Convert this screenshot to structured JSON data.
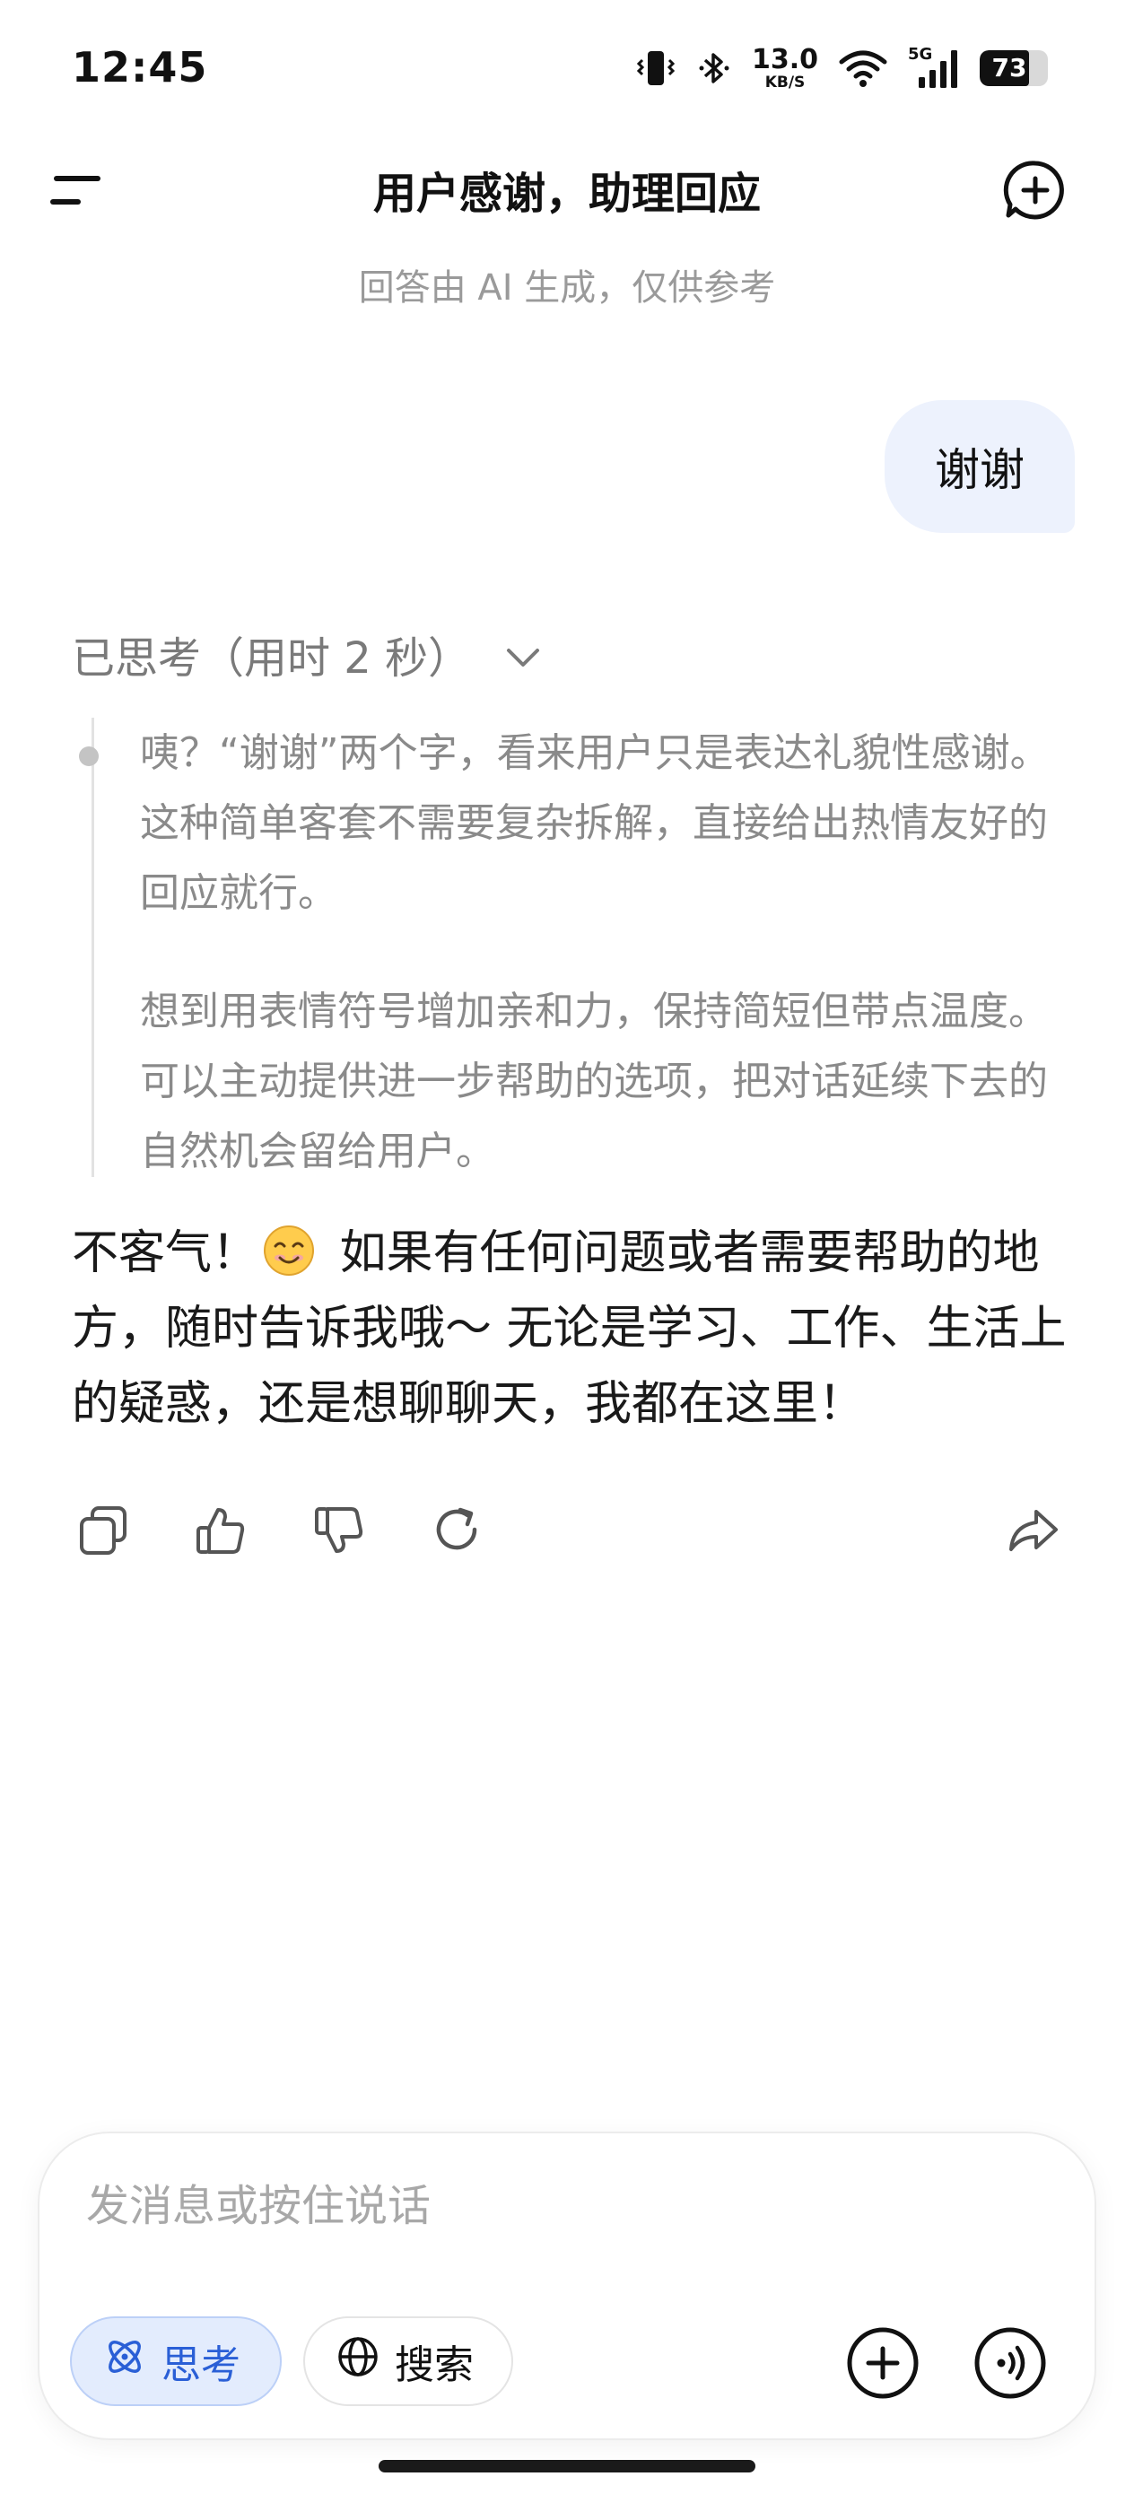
{
  "status_bar": {
    "time": "12:45",
    "net_speed_value": "13.0",
    "net_speed_unit": "KB/S",
    "network_type": "5G",
    "battery_percent": "73",
    "battery_level": 0.73,
    "icons": [
      "vibrate-icon",
      "bluetooth-icon",
      "wifi-icon",
      "cellular-signal-icon",
      "battery-icon"
    ]
  },
  "header": {
    "title": "用户感谢，助理回应",
    "notice": "回答由 AI 生成，仅供参考"
  },
  "conversation": {
    "user_message": "谢谢",
    "thinking": {
      "label": "已思考（用时 2 秒）",
      "paragraphs": [
        "咦？“谢谢”两个字，看来用户只是表达礼貌性感谢。这种简单客套不需要复杂拆解，直接给出热情友好的回应就行。",
        "想到用表情符号增加亲和力，保持简短但带点温度。可以主动提供进一步帮助的选项，把对话延续下去的自然机会留给用户。"
      ]
    },
    "answer": {
      "before_emoji": "不客气！",
      "after_emoji": " 如果有任何问题或者需要帮助的地方，随时告诉我哦～ 无论是学习、工作、生活上的疑惑，还是想聊聊天，我都在这里！"
    },
    "actions": [
      "copy-icon",
      "thumbs-up-icon",
      "thumbs-down-icon",
      "regenerate-icon",
      "share-icon"
    ]
  },
  "composer": {
    "placeholder": "发消息或按住说话",
    "value": "",
    "think_label": "思考",
    "search_label": "搜索"
  },
  "colors": {
    "accent": "#2a5fd6",
    "user_bubble": "#edf2fd",
    "muted_text": "#8a8a8a"
  }
}
